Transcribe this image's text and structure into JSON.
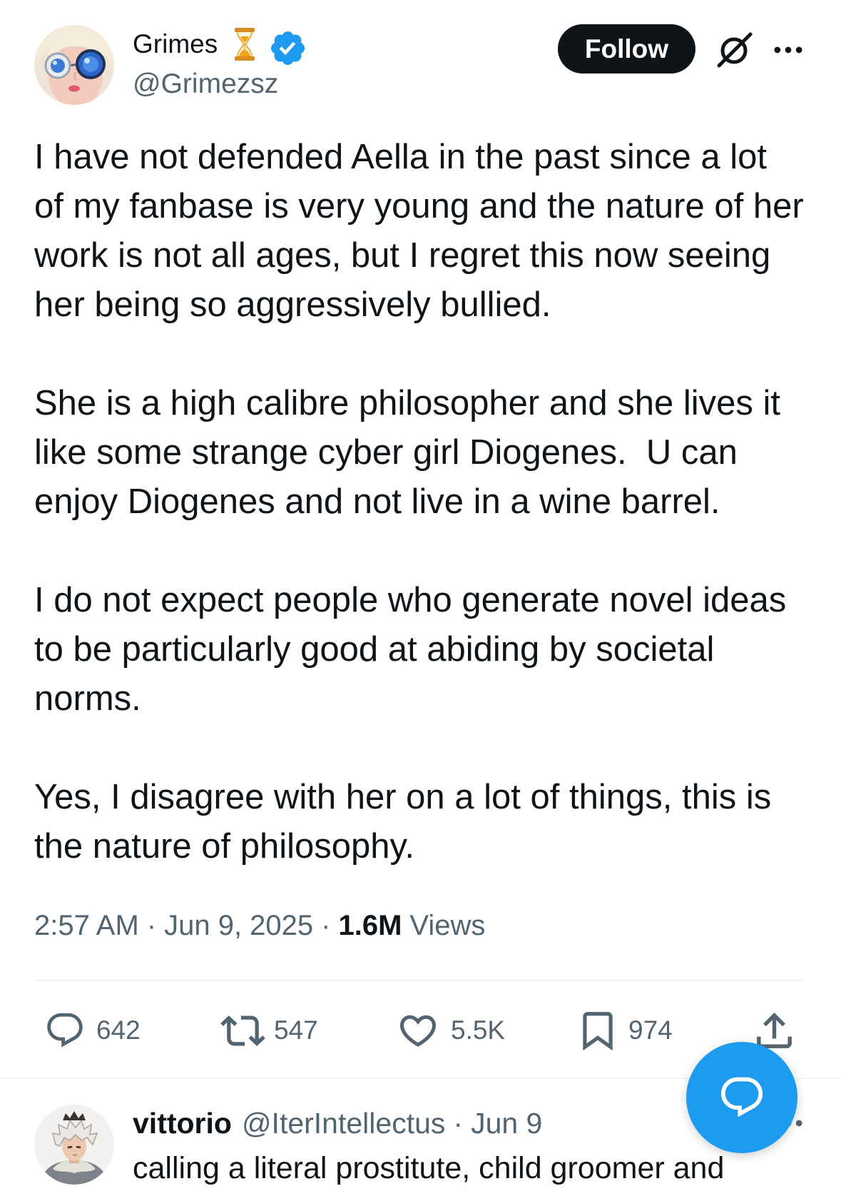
{
  "tweet": {
    "author": {
      "display_name": "Grimes",
      "handle": "@Grimezsz",
      "status_emoji_icon": "hourglass-icon",
      "verified_icon": "verified-badge-icon"
    },
    "follow_label": "Follow",
    "header_icons": {
      "grok": "grok-icon",
      "more": "more-icon"
    },
    "body": [
      {
        "lines": [
          "I have not defended Aella in the past since a lot",
          "of my fanbase is very young and the nature of her",
          "work is not all ages, but I regret this now seeing",
          "her being so aggressively bullied."
        ]
      },
      {
        "lines": [
          "She is a high calibre philosopher and she lives it",
          "like some strange cyber girl Diogenes.  U can",
          "enjoy Diogenes and not live in a wine barrel."
        ]
      },
      {
        "lines": [
          "I do not expect people who generate novel ideas",
          "to be particularly good at abiding by societal",
          "norms."
        ]
      },
      {
        "lines": [
          "Yes, I disagree with her on a lot of things, this is",
          "the nature of philosophy."
        ]
      }
    ],
    "meta": {
      "time": "2:57 AM",
      "separator": "·",
      "date": "Jun 9, 2025",
      "views_count": "1.6M",
      "views_label": "Views"
    },
    "actions": {
      "reply": {
        "icon": "reply-icon",
        "count": "642"
      },
      "repost": {
        "icon": "repost-icon",
        "count": "547"
      },
      "like": {
        "icon": "like-icon",
        "count": "5.5K"
      },
      "bookmark": {
        "icon": "bookmark-icon",
        "count": "974"
      },
      "share": {
        "icon": "share-icon"
      }
    }
  },
  "fab": {
    "icon": "chat-bubble-icon"
  },
  "reply": {
    "display_name": "vittorio",
    "handle": "@IterIntellectus",
    "separator": "·",
    "date": "Jun 9",
    "more_icon": "more-icon",
    "text": "calling a literal prostitute, child groomer and"
  },
  "colors": {
    "text": "#0f1419",
    "secondary": "#536471",
    "accent": "#1d9bf0",
    "divider": "#eff3f4",
    "follow_button": "#0f1419"
  }
}
